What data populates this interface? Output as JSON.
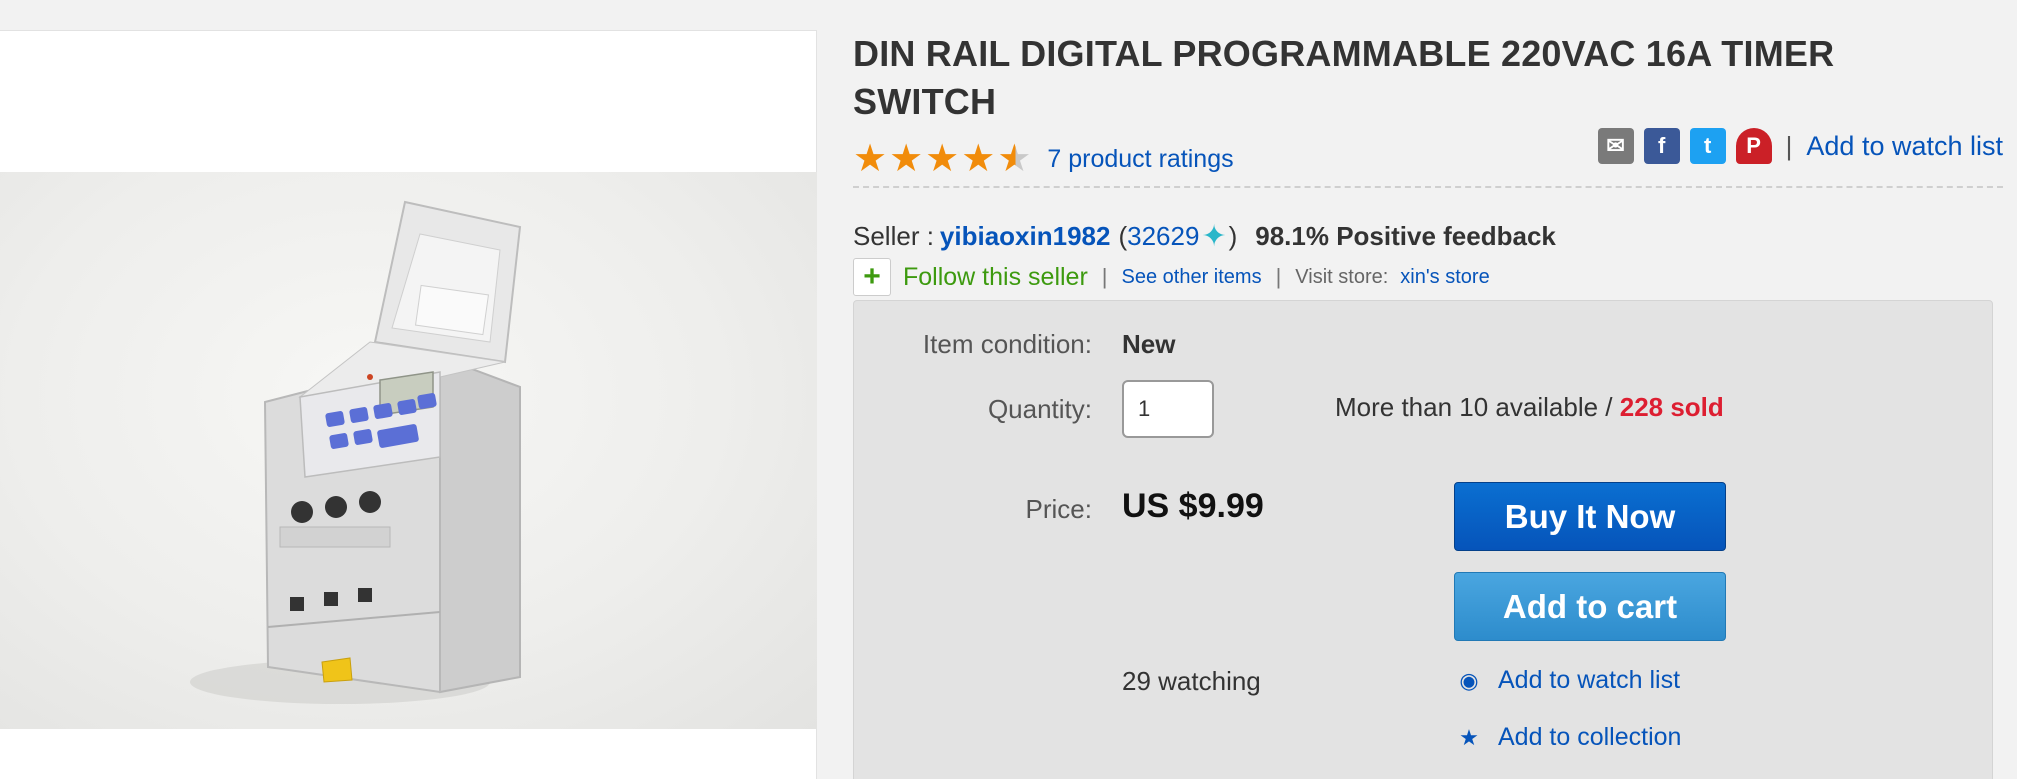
{
  "product": {
    "title": "DIN RAIL DIGITAL PROGRAMMABLE 220VAC 16A TIMER SWITCH",
    "rating": 4.5,
    "ratings_link": "7 product ratings"
  },
  "share": {
    "icons": [
      "email-icon",
      "facebook-icon",
      "twitter-icon",
      "pinterest-icon"
    ],
    "separator": "|",
    "watch_link": "Add to watch list"
  },
  "seller": {
    "label": "Seller :",
    "name": "yibiaoxin1982",
    "open_paren": "(",
    "score": "32629",
    "close_paren": ")",
    "feedback": "98.1% Positive feedback",
    "follow": "Follow this seller",
    "see_other": "See other items",
    "visit_label": "Visit store:",
    "store_name": "xin's store",
    "separator": "|"
  },
  "buybox": {
    "condition_label": "Item condition:",
    "condition_value": "New",
    "quantity_label": "Quantity:",
    "quantity_value": "1",
    "availability": "More than 10 available / ",
    "sold": "228 sold",
    "price_label": "Price:",
    "price_value": "US $9.99",
    "buy_now": "Buy It Now",
    "add_to_cart": "Add to cart",
    "watching": "29 watching",
    "add_to_watch": "Add to watch list",
    "add_to_collection": "Add to collection"
  },
  "colors": {
    "link": "#0654ba",
    "star": "#f18c0b",
    "sold": "#dd1e31",
    "follow": "#3d9a0f",
    "buy_now": "#0654ba",
    "add_to_cart": "#2d8ccc"
  }
}
